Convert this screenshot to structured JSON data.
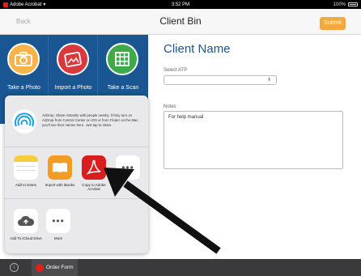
{
  "status_bar": {
    "app": "Adobe Acrobat",
    "time": "3:52 PM",
    "battery": "100%"
  },
  "nav": {
    "back": "Back",
    "title": "Client Bin",
    "submit": "Submit"
  },
  "tiles": [
    {
      "label": "Take a Photo",
      "icon": "camera-icon",
      "color": "#f6b44a"
    },
    {
      "label": "Import a Photo",
      "icon": "import-photo-icon",
      "color": "#d9383c"
    },
    {
      "label": "Take a Scan",
      "icon": "scan-grid-icon",
      "color": "#3eaa4a"
    }
  ],
  "form": {
    "title": "Client Name",
    "select_label": "Select ATP",
    "select_value": "",
    "notes_label": "Notes",
    "notes_value": "For help manual"
  },
  "share_sheet": {
    "airdrop_text": "AirDrop. Share instantly with people nearby. If they turn on AirDrop from Control Center on iOS or from Finder on the Mac, you'll see their names here. Just tap to share.",
    "row1": [
      {
        "label": "Add to Notes",
        "icon": "notes-icon"
      },
      {
        "label": "Import with iBooks",
        "icon": "ibooks-icon"
      },
      {
        "label": "Copy to Adobe Acrobat",
        "icon": "acrobat-icon"
      },
      {
        "label": "",
        "icon": "more-icon"
      }
    ],
    "row2": [
      {
        "label": "Add To iCloud Drive",
        "icon": "icloud-upload-icon"
      },
      {
        "label": "More",
        "icon": "more-icon"
      }
    ]
  },
  "bottom_bar": {
    "info": "i",
    "tab_label": "Order Form"
  },
  "colors": {
    "brand_blue": "#1a5691",
    "submit_orange": "#f3a93b",
    "acrobat_red": "#e1201b"
  }
}
